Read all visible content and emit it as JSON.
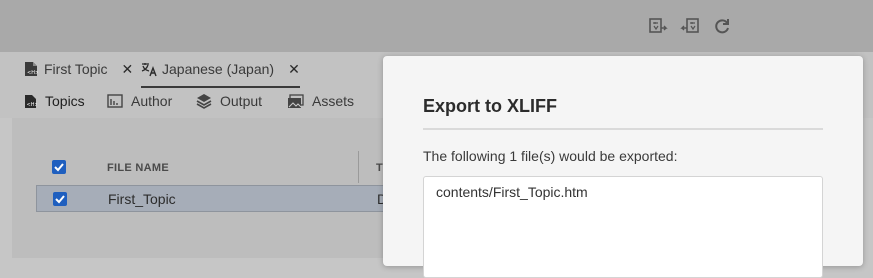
{
  "toolbar": {
    "icons": [
      "translate-export-icon",
      "translate-import-icon",
      "refresh-icon"
    ]
  },
  "tabs": [
    {
      "label": "First Topic",
      "icon": "topic-icon",
      "close": "✕"
    },
    {
      "label": "Japanese (Japan)",
      "icon": "translate-icon",
      "close": "✕"
    }
  ],
  "nav": [
    {
      "label": "Topics",
      "icon": "topics-icon"
    },
    {
      "label": "Author",
      "icon": "author-icon"
    },
    {
      "label": "Output",
      "icon": "layers-icon"
    },
    {
      "label": "Assets",
      "icon": "assets-icon"
    }
  ],
  "table": {
    "headers": [
      "FILE NAME",
      "T"
    ],
    "rows": [
      {
        "name": "First_Topic",
        "second": "D",
        "checked": true
      }
    ],
    "select_all_checked": true
  },
  "dialog": {
    "title": "Export to XLIFF",
    "message": "The following 1 file(s) would be exported:",
    "files": [
      "contents/First_Topic.htm"
    ]
  },
  "colors": {
    "accent": "#1f5fbf",
    "overlay": "#a9a9a9",
    "dialog_bg": "#f5f5f5"
  }
}
